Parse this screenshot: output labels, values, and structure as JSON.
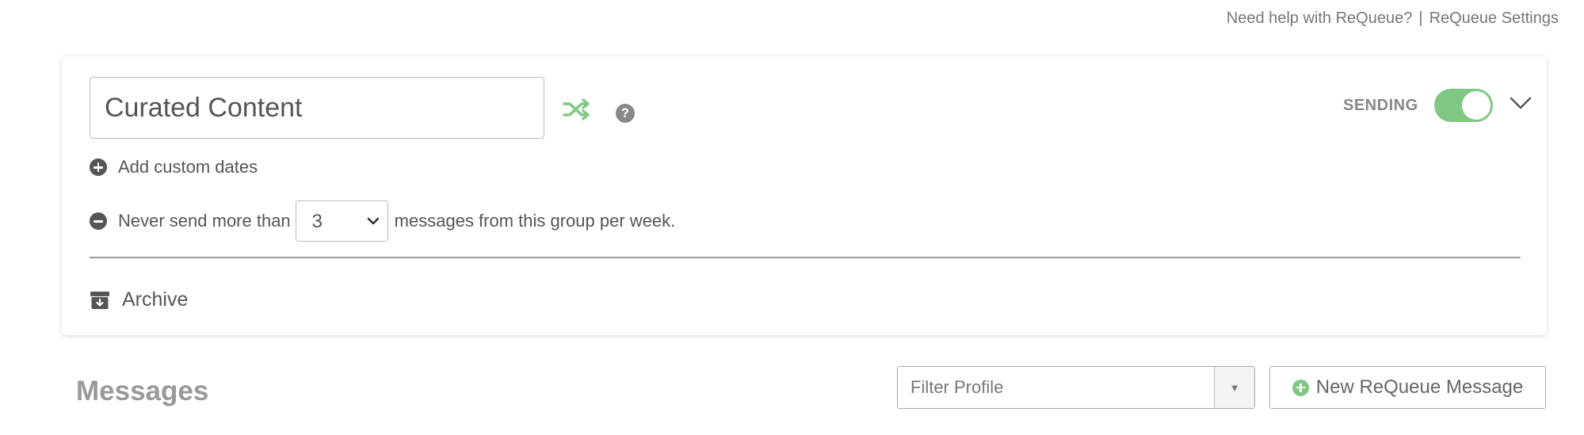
{
  "header": {
    "help_link": "Need help with ReQueue?",
    "separator": "|",
    "settings_link": "ReQueue Settings"
  },
  "group": {
    "title": "Curated Content",
    "sending_label": "SENDING",
    "sending_enabled": true,
    "add_custom_dates": "Add custom dates",
    "limit_prefix": "Never send more than",
    "limit_value": "3",
    "limit_suffix": "messages from this group per week.",
    "archive_label": "Archive",
    "icons": {
      "shuffle": "shuffle-icon",
      "help": "question-circle-icon",
      "expand": "chevron-down-icon",
      "add": "plus-circle-icon",
      "limit": "minus-circle-icon",
      "archive": "archive-box-icon"
    },
    "help_glyph": "?"
  },
  "messages": {
    "heading": "Messages",
    "filter_placeholder": "Filter Profile",
    "filter_dropdown_glyph": "▼",
    "new_button_label": "New ReQueue Message"
  },
  "colors": {
    "accent_green": "#81c784",
    "text": "#555555",
    "muted": "#999999"
  }
}
